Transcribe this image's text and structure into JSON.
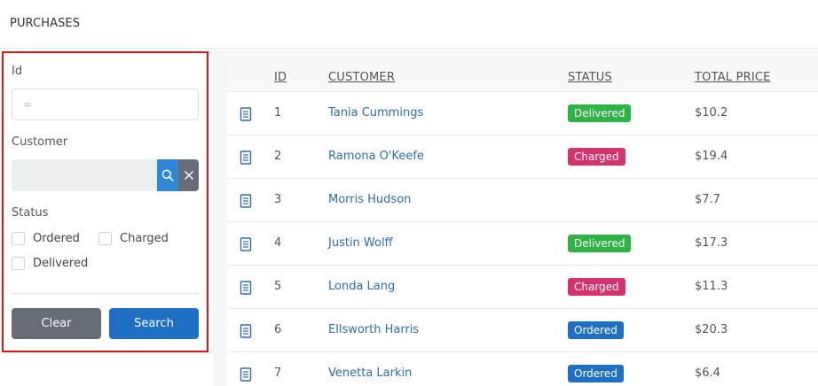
{
  "header": {
    "title": "PURCHASES"
  },
  "filters": {
    "id_label": "Id",
    "id_placeholder": "=",
    "customer_label": "Customer",
    "status_label": "Status",
    "status_options": [
      {
        "label": "Ordered",
        "checked": false
      },
      {
        "label": "Charged",
        "checked": false
      },
      {
        "label": "Delivered",
        "checked": false
      }
    ],
    "clear_label": "Clear",
    "search_label": "Search"
  },
  "table": {
    "columns": [
      "ID",
      "CUSTOMER",
      "STATUS",
      "TOTAL PRICE"
    ],
    "rows": [
      {
        "id": "1",
        "customer": "Tania Cummings",
        "status": "Delivered",
        "price": "$10.2"
      },
      {
        "id": "2",
        "customer": "Ramona O'Keefe",
        "status": "Charged",
        "price": "$19.4"
      },
      {
        "id": "3",
        "customer": "Morris Hudson",
        "status": "",
        "price": "$7.7"
      },
      {
        "id": "4",
        "customer": "Justin Wolff",
        "status": "Delivered",
        "price": "$17.3"
      },
      {
        "id": "5",
        "customer": "Londa Lang",
        "status": "Charged",
        "price": "$11.3"
      },
      {
        "id": "6",
        "customer": "Ellsworth Harris",
        "status": "Ordered",
        "price": "$20.3"
      },
      {
        "id": "7",
        "customer": "Venetta Larkin",
        "status": "Ordered",
        "price": "$6.4"
      }
    ]
  },
  "colors": {
    "highlight_border": "#e11414",
    "delivered": "#2fb344",
    "charged": "#d6336c",
    "ordered": "#1f6fc5",
    "link": "#2b6cb8",
    "search_button": "#1f6fc5",
    "clear_button": "#676d75"
  },
  "icons": {
    "row": "document-icon",
    "customer_search": "search-icon",
    "customer_clear": "close-icon"
  }
}
